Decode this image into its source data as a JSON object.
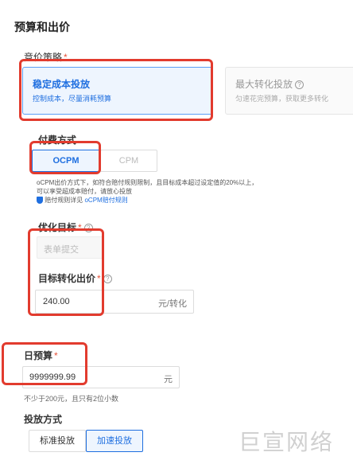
{
  "section_title": "预算和出价",
  "bid_strategy": {
    "label": "竞价策略",
    "required_mark": "*",
    "options": [
      {
        "title": "稳定成本投放",
        "desc": "控制成本，尽量消耗预算",
        "selected": true
      },
      {
        "title": "最大转化投放",
        "desc": "匀速花完预算，获取更多转化",
        "selected": false
      }
    ]
  },
  "payment": {
    "label": "付费方式",
    "options": [
      {
        "label": "OCPM",
        "selected": true
      },
      {
        "label": "CPM",
        "selected": false
      }
    ],
    "note_line1": "oCPM出价方式下，如符合赔付规则限制，且目标成本超过设定值的20%以上，",
    "note_line2": "可以享受超成本赔付，请放心投放",
    "note_line3_prefix": "赔付规则详见",
    "note_line3_link": "oCPM赔付规则"
  },
  "optimize_goal": {
    "label": "优化目标",
    "required_mark": "*",
    "value": "表单提交"
  },
  "target_bid": {
    "label": "目标转化出价",
    "required_mark": "*",
    "value": "240.00",
    "unit": "元/转化"
  },
  "daily_budget": {
    "label": "日预算",
    "required_mark": "*",
    "value": "9999999.99",
    "unit": "元",
    "hint": "不少于200元，且只有2位小数"
  },
  "delivery": {
    "label": "投放方式",
    "options": [
      {
        "label": "标准投放",
        "selected": false
      },
      {
        "label": "加速投放",
        "selected": true
      }
    ]
  },
  "watermark": "巨宣网络",
  "colors": {
    "accent": "#1f6fe0",
    "highlight_box": "#e23b2e",
    "required": "#e5533a"
  }
}
